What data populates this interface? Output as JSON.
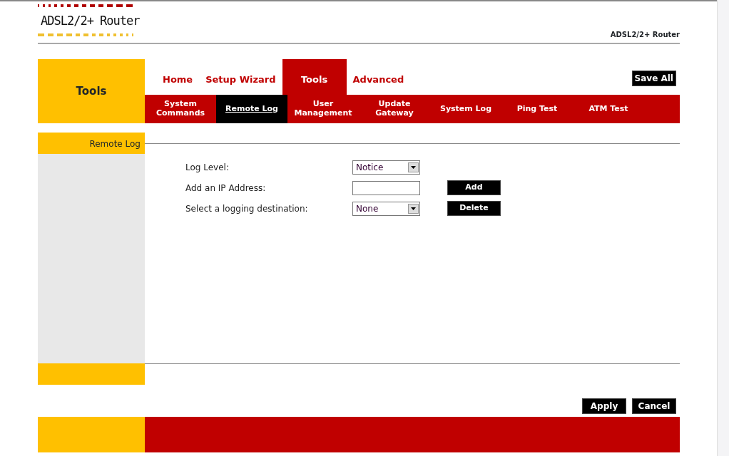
{
  "header": {
    "logo": "ADSL2/2+ Router",
    "product": "ADSL2/2+ Router"
  },
  "section_title": "Tools",
  "tabs": [
    {
      "label": "Home",
      "selected": false
    },
    {
      "label": "Setup Wizard",
      "selected": false
    },
    {
      "label": "Tools",
      "selected": true
    },
    {
      "label": "Advanced",
      "selected": false
    }
  ],
  "save_all": "Save All",
  "subtabs": [
    {
      "label": "System Commands",
      "selected": false
    },
    {
      "label": "Remote Log",
      "selected": true
    },
    {
      "label": "User Management",
      "selected": false
    },
    {
      "label": "Update Gateway",
      "selected": false
    },
    {
      "label": "System Log",
      "selected": false
    },
    {
      "label": "Ping Test",
      "selected": false
    },
    {
      "label": "ATM Test",
      "selected": false
    }
  ],
  "sidebar_title": "Remote Log",
  "form": [
    {
      "label": "Log Level:",
      "kind": "select",
      "value": "Notice"
    },
    {
      "label": "Add an IP Address:",
      "kind": "input",
      "button": "Add"
    },
    {
      "label": "Select a logging destination:",
      "kind": "select",
      "value": "None",
      "button": "Delete"
    }
  ],
  "buttons": [
    "Apply",
    "Cancel"
  ]
}
